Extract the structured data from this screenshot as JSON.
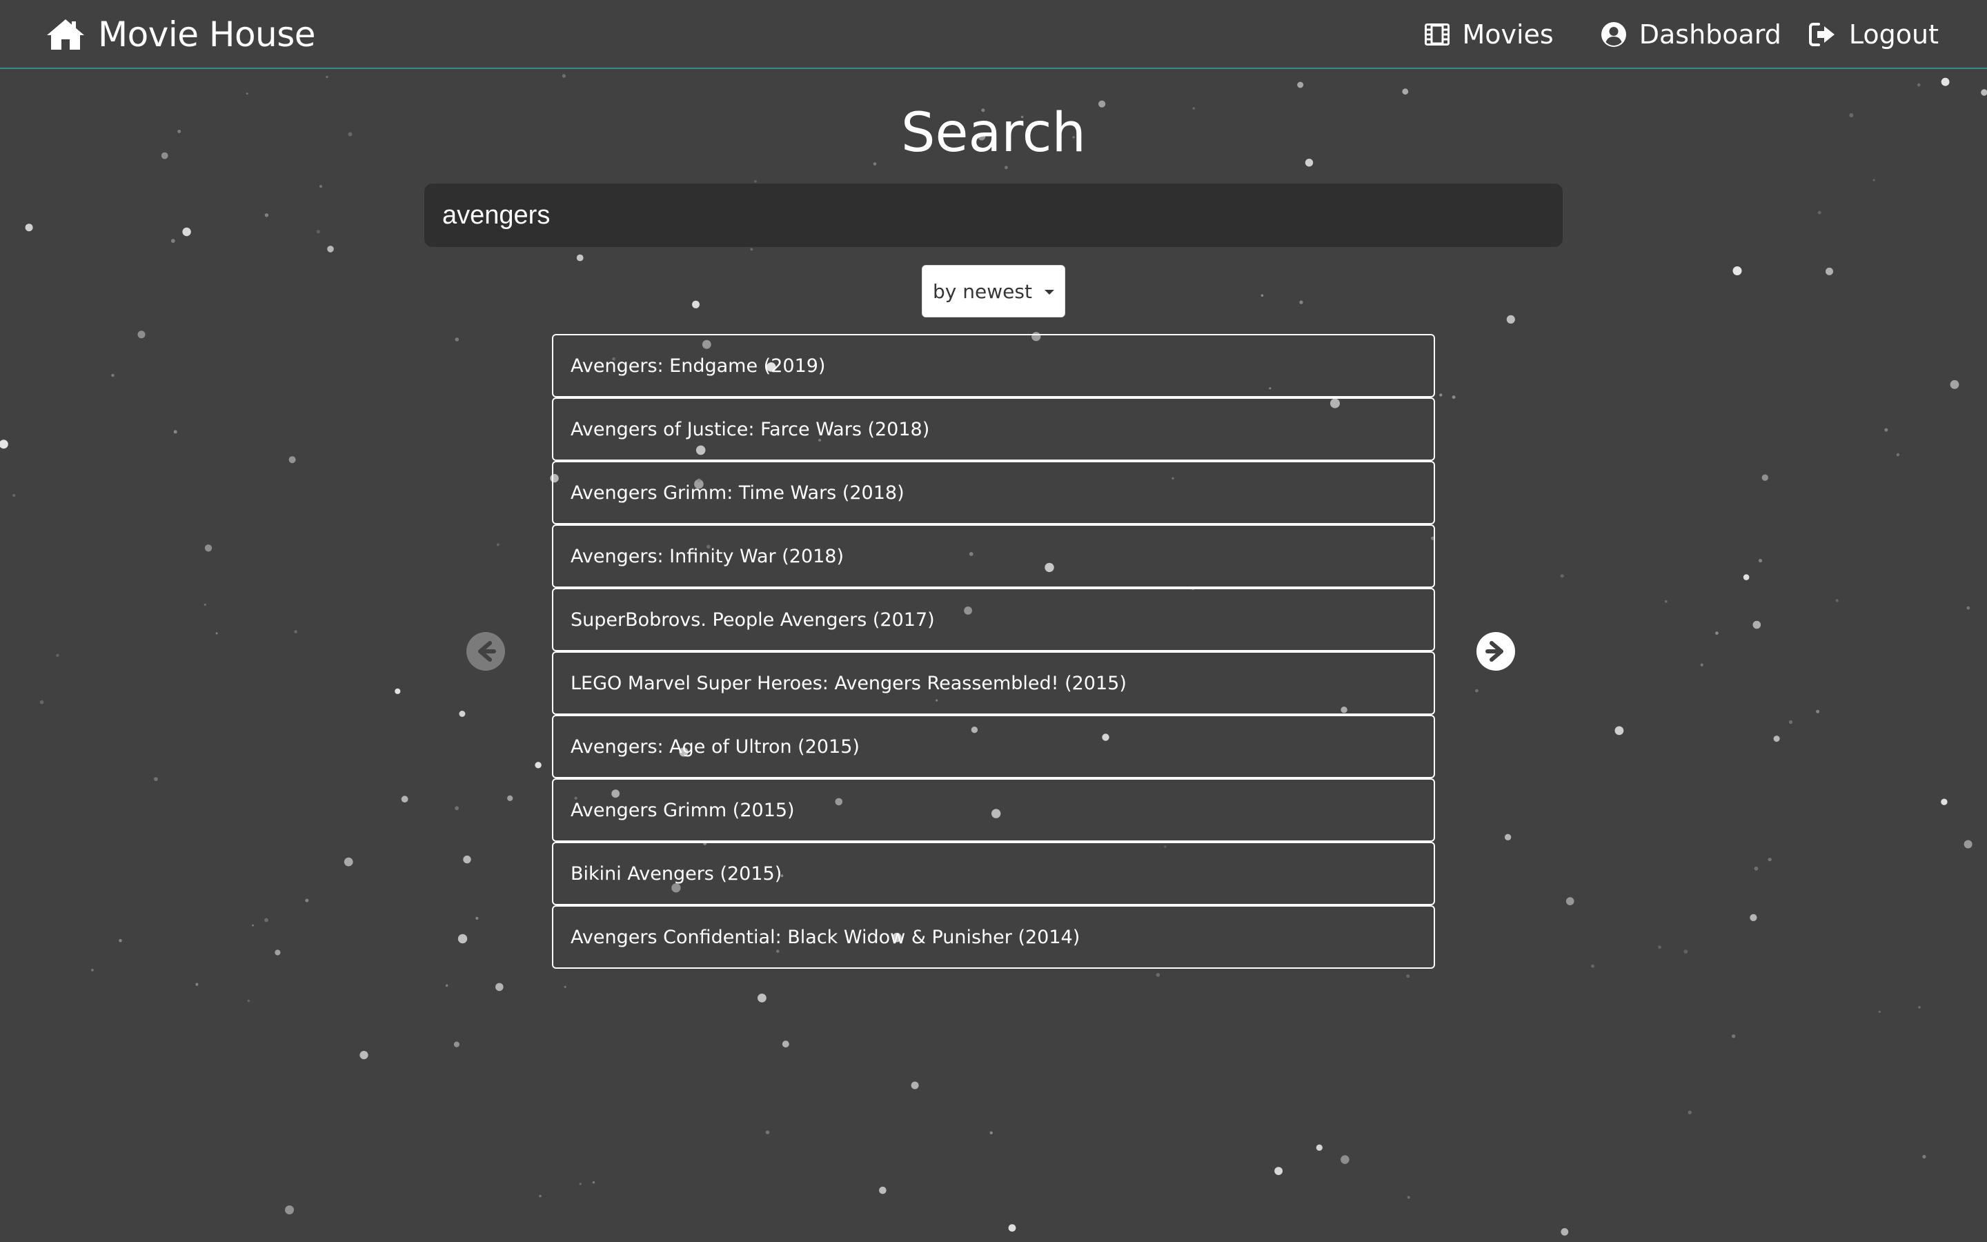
{
  "navbar": {
    "brand_label": "Movie House",
    "brand_icon": "home-icon",
    "links": [
      {
        "label": "Movies",
        "icon": "film-icon"
      },
      {
        "label": "Dashboard",
        "icon": "user-circle-icon"
      },
      {
        "label": "Logout",
        "icon": "sign-out-icon"
      }
    ]
  },
  "main": {
    "title": "Search",
    "search": {
      "value": "avengers",
      "placeholder": ""
    },
    "sort": {
      "selected": "by newest"
    },
    "results": [
      "Avengers: Endgame (2019)",
      "Avengers of Justice: Farce Wars (2018)",
      "Avengers Grimm: Time Wars (2018)",
      "Avengers: Infinity War (2018)",
      "SuperBobrovs. People Avengers (2017)",
      "LEGO Marvel Super Heroes: Avengers Reassembled! (2015)",
      "Avengers: Age of Ultron (2015)",
      "Avengers Grimm (2015)",
      "Bikini Avengers (2015)",
      "Avengers Confidential: Black Widow & Punisher (2014)"
    ],
    "pagination": {
      "prev_icon": "arrow-left-circle-icon",
      "next_icon": "arrow-right-circle-icon"
    }
  },
  "colors": {
    "background": "#414141",
    "navbar_border": "#2f8f86",
    "input_background": "#2f2f2f",
    "text": "#ffffff"
  }
}
